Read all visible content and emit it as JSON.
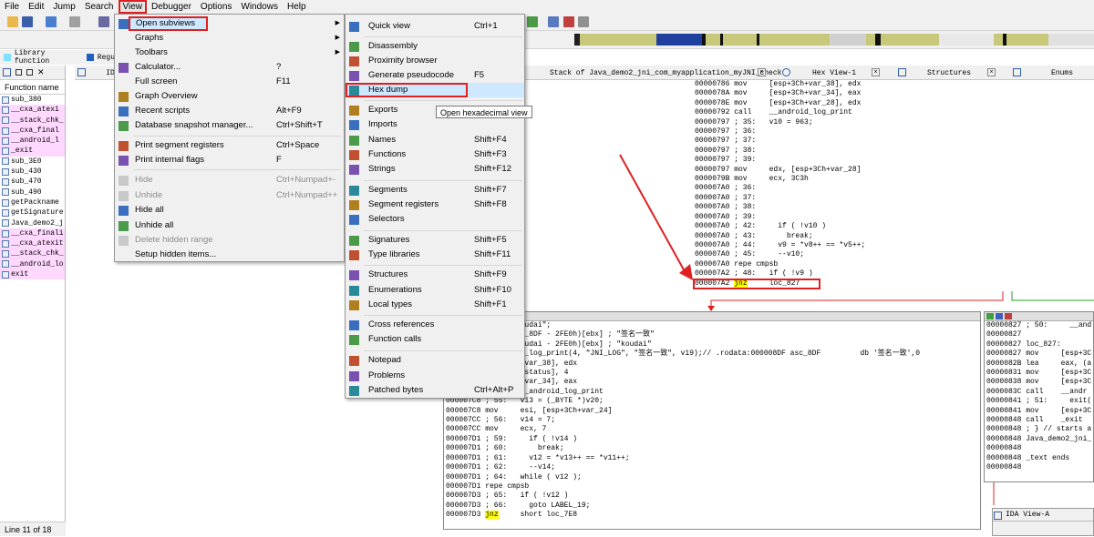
{
  "menubar": [
    "File",
    "Edit",
    "Jump",
    "Search",
    "View",
    "Debugger",
    "Options",
    "Windows",
    "Help"
  ],
  "legend": {
    "library": "Library function",
    "regular": "Regu"
  },
  "functions_window": {
    "title": "Function name",
    "tab_label": "ID",
    "items": [
      {
        "name": "sub_380",
        "pink": false
      },
      {
        "name": "__cxa_atexi",
        "pink": true
      },
      {
        "name": "__stack_chk_",
        "pink": true
      },
      {
        "name": "__cxa_final",
        "pink": true
      },
      {
        "name": "__android_l",
        "pink": true
      },
      {
        "name": "_exit",
        "pink": true
      },
      {
        "name": "sub_3E0",
        "pink": false
      },
      {
        "name": "sub_430",
        "pink": false
      },
      {
        "name": "sub_470",
        "pink": false
      },
      {
        "name": "sub_490",
        "pink": false
      },
      {
        "name": "getPackname",
        "pink": false
      },
      {
        "name": "getSignature",
        "pink": false
      },
      {
        "name": "Java_demo2_j",
        "pink": false
      },
      {
        "name": "__cxa_finali",
        "pink": true
      },
      {
        "name": "__cxa_atexit",
        "pink": true
      },
      {
        "name": "__stack_chk_",
        "pink": true
      },
      {
        "name": "__android_lo",
        "pink": true
      },
      {
        "name": "exit",
        "pink": true
      }
    ],
    "status": "Line 11 of 18"
  },
  "tabs": [
    {
      "label": "Stack of Java_demo2_jni_com_myapplication_myJNI_check"
    },
    {
      "label": "Hex View-1"
    },
    {
      "label": "Structures"
    },
    {
      "label": "Enums"
    }
  ],
  "view_menu": [
    {
      "label": "Open subviews",
      "shortcut": "",
      "submenu": true,
      "disabled": false,
      "icon": "subviews-icon"
    },
    {
      "label": "Graphs",
      "shortcut": "",
      "submenu": true,
      "disabled": false,
      "icon": ""
    },
    {
      "label": "Toolbars",
      "shortcut": "",
      "submenu": true,
      "disabled": false,
      "icon": ""
    },
    {
      "label": "Calculator...",
      "shortcut": "?",
      "submenu": false,
      "disabled": false,
      "icon": "calculator-icon"
    },
    {
      "label": "Full screen",
      "shortcut": "F11",
      "submenu": false,
      "disabled": false,
      "icon": ""
    },
    {
      "label": "Graph Overview",
      "shortcut": "",
      "submenu": false,
      "disabled": false,
      "icon": "graph-overview-icon"
    },
    {
      "label": "Recent scripts",
      "shortcut": "Alt+F9",
      "submenu": false,
      "disabled": false,
      "icon": "scripts-icon"
    },
    {
      "label": "Database snapshot manager...",
      "shortcut": "Ctrl+Shift+T",
      "submenu": false,
      "disabled": false,
      "icon": "snapshot-icon"
    },
    {
      "label": "Print segment registers",
      "shortcut": "Ctrl+Space",
      "submenu": false,
      "disabled": false,
      "icon": "segment-registers-icon"
    },
    {
      "label": "Print internal flags",
      "shortcut": "F",
      "submenu": false,
      "disabled": false,
      "icon": "info-icon"
    },
    {
      "label": "Hide",
      "shortcut": "Ctrl+Numpad+-",
      "submenu": false,
      "disabled": true,
      "icon": "hide-icon"
    },
    {
      "label": "Unhide",
      "shortcut": "Ctrl+Numpad++",
      "submenu": false,
      "disabled": true,
      "icon": "unhide-icon"
    },
    {
      "label": "Hide all",
      "shortcut": "",
      "submenu": false,
      "disabled": false,
      "icon": "hide-all-icon"
    },
    {
      "label": "Unhide all",
      "shortcut": "",
      "submenu": false,
      "disabled": false,
      "icon": "unhide-all-icon"
    },
    {
      "label": "Delete hidden range",
      "shortcut": "",
      "submenu": false,
      "disabled": true,
      "icon": "delete-icon"
    },
    {
      "label": "Setup hidden items...",
      "shortcut": "",
      "submenu": false,
      "disabled": false,
      "icon": ""
    }
  ],
  "subviews_menu": [
    {
      "label": "Quick view",
      "shortcut": "Ctrl+1",
      "icon": "quick-view-icon"
    },
    {
      "label": "Disassembly",
      "shortcut": "",
      "icon": "disassembly-icon"
    },
    {
      "label": "Proximity browser",
      "shortcut": "",
      "icon": "proximity-icon"
    },
    {
      "label": "Generate pseudocode",
      "shortcut": "F5",
      "icon": "pseudocode-icon"
    },
    {
      "label": "Hex dump",
      "shortcut": "",
      "icon": "hex-dump-icon"
    },
    {
      "label": "Exports",
      "shortcut": "",
      "icon": "exports-icon"
    },
    {
      "label": "Imports",
      "shortcut": "",
      "icon": "imports-icon"
    },
    {
      "label": "Names",
      "shortcut": "Shift+F4",
      "icon": "names-icon"
    },
    {
      "label": "Functions",
      "shortcut": "Shift+F3",
      "icon": "functions-icon"
    },
    {
      "label": "Strings",
      "shortcut": "Shift+F12",
      "icon": "strings-icon"
    },
    {
      "label": "Segments",
      "shortcut": "Shift+F7",
      "icon": "segments-icon"
    },
    {
      "label": "Segment registers",
      "shortcut": "Shift+F8",
      "icon": "segment-registers-icon"
    },
    {
      "label": "Selectors",
      "shortcut": "",
      "icon": "selectors-icon"
    },
    {
      "label": "Signatures",
      "shortcut": "Shift+F5",
      "icon": "signatures-icon"
    },
    {
      "label": "Type libraries",
      "shortcut": "Shift+F11",
      "icon": "type-libraries-icon"
    },
    {
      "label": "Structures",
      "shortcut": "Shift+F9",
      "icon": "structures-icon"
    },
    {
      "label": "Enumerations",
      "shortcut": "Shift+F10",
      "icon": "enumerations-icon"
    },
    {
      "label": "Local types",
      "shortcut": "Shift+F1",
      "icon": "local-types-icon"
    },
    {
      "label": "Cross references",
      "shortcut": "",
      "icon": "cross-references-icon"
    },
    {
      "label": "Function calls",
      "shortcut": "",
      "icon": "function-calls-icon"
    },
    {
      "label": "Notepad",
      "shortcut": "",
      "icon": "notepad-icon"
    },
    {
      "label": "Problems",
      "shortcut": "",
      "icon": "problems-icon"
    },
    {
      "label": "Patched bytes",
      "shortcut": "Ctrl+Alt+P",
      "icon": "patched-bytes-icon"
    }
  ],
  "tooltip": "Open hexadecimal view",
  "node1_lines": [
    "00000786 mov     [esp+3Ch+var_38], edx",
    "0000078A mov     [esp+3Ch+var_34], eax",
    "0000078E mov     [esp+3Ch+var_28], edx",
    "00000792 call    __android_log_print",
    "00000797 ; 35:   v10 = 963;",
    "00000797 ; 36:",
    "00000797 ; 37:",
    "00000797 ; 38:",
    "00000797 ; 39:",
    "00000797 mov     edx, [esp+3Ch+var_28]",
    "0000079B mov     ecx, 3C3h",
    "000007A0 ; 36:",
    "000007A0 ; 37:",
    "000007A0 ; 38:",
    "000007A0 ; 39:",
    "000007A0 ; 42:     if ( !v10 )",
    "000007A0 ; 43:       break;",
    "000007A0 ; 44:     v9 = *v8++ == *v5++;",
    "000007A0 ; 45:     --v10;",
    "000007A0 repe cmpsb",
    "000007A2 ; 48:   if ( !v9 )",
    "000007A2 jnz     loc_827"
  ],
  "node2_lines": [
    "          11 = \"koudai\";",
    "          ax, (asc_8DF - 2FE0h)[ebx] ; \"签名一致\"",
    "          di, (aKoudai - 2FE0h)[ebx] ; \"koudai\"",
    "          _android_log_print(4, \"JNI_LOG\", \"签名一致\", v19);// .rodata:000008DF asc_8DF         db '签名一致',0",
    "          esp+3Ch+var_38], edx",
    "          esp+3Ch+status], 4",
    "          esp+3Ch+var_34], eax",
    "000007C3 call    __android_log_print",
    "000007C8 ; 55:   v13 = (_BYTE *)v20;",
    "000007C8 mov     esi, [esp+3Ch+var_24]",
    "000007CC ; 56:   v14 = 7;",
    "000007CC mov     ecx, 7",
    "000007D1 ; 59:     if ( !v14 )",
    "000007D1 ; 60:       break;",
    "000007D1 ; 61:     v12 = *v13++ == *v11++;",
    "000007D1 ; 62:     --v14;",
    "000007D1 ; 64:   while ( v12 );",
    "000007D1 repe cmpsb",
    "000007D3 ; 65:   if ( !v12 )",
    "000007D3 ; 66:     goto LABEL_19;",
    "000007D3 jnz     short loc_7E8"
  ],
  "node3_lines": [
    "00000827 ; 50:     __and",
    "00000827",
    "00000827 loc_827:",
    "00000827 mov     [esp+3C",
    "0000082B lea     eax, (a",
    "00000831 mov     [esp+3C",
    "00000838 mov     [esp+3C",
    "0000083C call    __andr",
    "00000841 ; 51:     exit(",
    "00000841 mov     [esp+3C",
    "00000848 call    _exit",
    "00000848 ; } // starts a",
    "00000848 Java_demo2_jni_",
    "00000848",
    "00000848 _text ends",
    "00000848"
  ],
  "ida_view_tab": "IDA View-A",
  "colors": {
    "accent_red": "#e02020",
    "highlight_blue": "#cde8ff",
    "pink": "#ffd8ff"
  }
}
